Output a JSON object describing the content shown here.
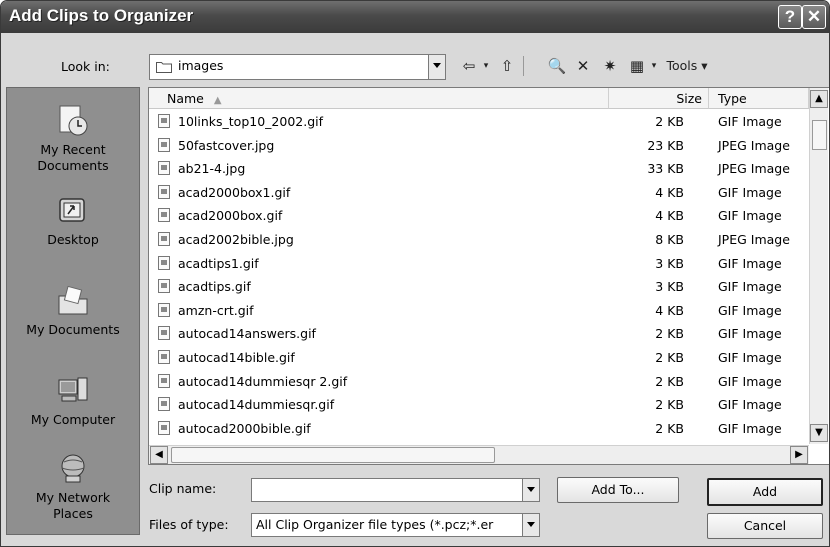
{
  "window": {
    "title": "Add Clips to Organizer",
    "help_glyph": "?",
    "close_glyph": "✕"
  },
  "lookin": {
    "label": "Look in:",
    "value": "images"
  },
  "toolbar": {
    "tools_label": "Tools",
    "back_glyph": "⇦",
    "up_glyph": "⇧",
    "search_glyph": "🔍",
    "delete_glyph": "✕",
    "newfolder_glyph": "✷",
    "views_glyph": "▦"
  },
  "places": [
    {
      "label": "My Recent\nDocuments",
      "icon": "recent-documents-icon"
    },
    {
      "label": "Desktop",
      "icon": "desktop-icon"
    },
    {
      "label": "My Documents",
      "icon": "my-documents-icon"
    },
    {
      "label": "My Computer",
      "icon": "my-computer-icon"
    },
    {
      "label": "My Network\nPlaces",
      "icon": "network-places-icon"
    }
  ],
  "columns": {
    "name": "Name",
    "size": "Size",
    "type": "Type"
  },
  "files": [
    {
      "name": "10links_top10_2002.gif",
      "size": "2 KB",
      "type": "GIF Image"
    },
    {
      "name": "50fastcover.jpg",
      "size": "23 KB",
      "type": "JPEG Image"
    },
    {
      "name": "ab21-4.jpg",
      "size": "33 KB",
      "type": "JPEG Image"
    },
    {
      "name": "acad2000box1.gif",
      "size": "4 KB",
      "type": "GIF Image"
    },
    {
      "name": "acad2000box.gif",
      "size": "4 KB",
      "type": "GIF Image"
    },
    {
      "name": "acad2002bible.jpg",
      "size": "8 KB",
      "type": "JPEG Image"
    },
    {
      "name": "acadtips1.gif",
      "size": "3 KB",
      "type": "GIF Image"
    },
    {
      "name": "acadtips.gif",
      "size": "3 KB",
      "type": "GIF Image"
    },
    {
      "name": "amzn-crt.gif",
      "size": "4 KB",
      "type": "GIF Image"
    },
    {
      "name": "autocad14answers.gif",
      "size": "2 KB",
      "type": "GIF Image"
    },
    {
      "name": "autocad14bible.gif",
      "size": "2 KB",
      "type": "GIF Image"
    },
    {
      "name": "autocad14dummiesqr 2.gif",
      "size": "2 KB",
      "type": "GIF Image"
    },
    {
      "name": "autocad14dummiesqr.gif",
      "size": "2 KB",
      "type": "GIF Image"
    },
    {
      "name": "autocad2000bible.gif",
      "size": "2 KB",
      "type": "GIF Image"
    }
  ],
  "clip_name": {
    "label": "Clip name:",
    "value": ""
  },
  "file_type": {
    "label": "Files of type:",
    "value": "All Clip Organizer file types  (*.pcz;*.er"
  },
  "buttons": {
    "add_to": "Add To...",
    "add": "Add",
    "cancel": "Cancel"
  }
}
